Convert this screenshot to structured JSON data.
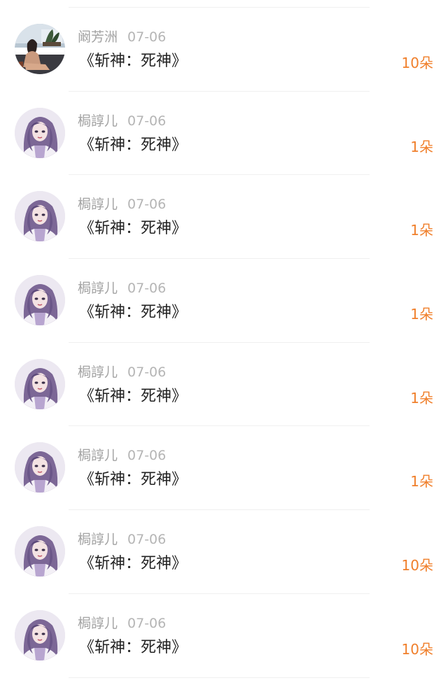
{
  "colors": {
    "accent": "#f07f2b",
    "meta_text": "#a3a3a3",
    "title_text": "#222222",
    "divider": "#f0f0f0"
  },
  "rows": [
    {
      "user": "阚芳洲",
      "date": "07-06",
      "title": "《斩神：死神》",
      "flowers": "10朵",
      "avatar": "avatar-photo-woman-sitting"
    },
    {
      "user": "梮諄儿",
      "date": "07-06",
      "title": "《斩神：死神》",
      "flowers": "1朵",
      "avatar": "avatar-anime-girl-purple-hair"
    },
    {
      "user": "梮諄儿",
      "date": "07-06",
      "title": "《斩神：死神》",
      "flowers": "1朵",
      "avatar": "avatar-anime-girl-purple-hair"
    },
    {
      "user": "梮諄儿",
      "date": "07-06",
      "title": "《斩神：死神》",
      "flowers": "1朵",
      "avatar": "avatar-anime-girl-purple-hair"
    },
    {
      "user": "梮諄儿",
      "date": "07-06",
      "title": "《斩神：死神》",
      "flowers": "1朵",
      "avatar": "avatar-anime-girl-purple-hair"
    },
    {
      "user": "梮諄儿",
      "date": "07-06",
      "title": "《斩神：死神》",
      "flowers": "1朵",
      "avatar": "avatar-anime-girl-purple-hair"
    },
    {
      "user": "梮諄儿",
      "date": "07-06",
      "title": "《斩神：死神》",
      "flowers": "10朵",
      "avatar": "avatar-anime-girl-purple-hair"
    },
    {
      "user": "梮諄儿",
      "date": "07-06",
      "title": "《斩神：死神》",
      "flowers": "10朵",
      "avatar": "avatar-anime-girl-purple-hair"
    }
  ]
}
